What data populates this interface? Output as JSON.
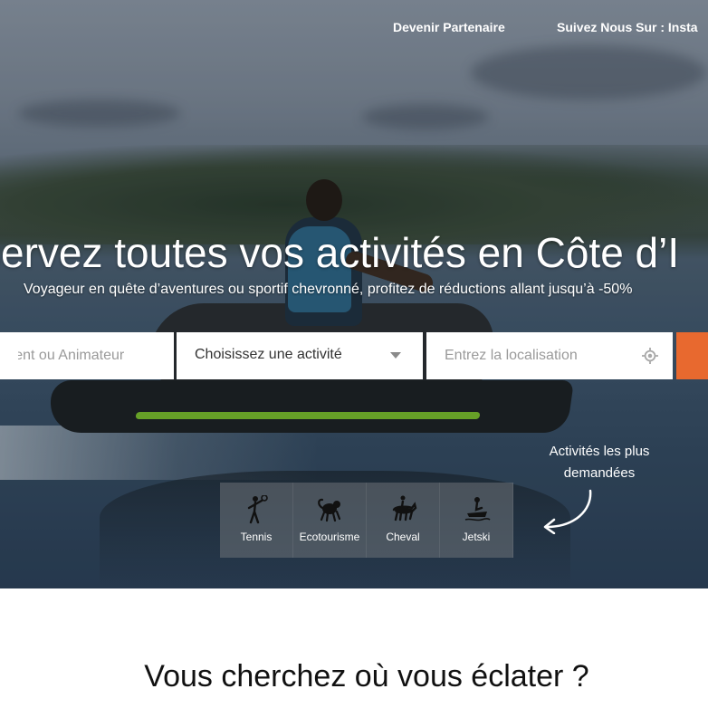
{
  "nav": {
    "partner": "Devenir Partenaire",
    "follow": "Suivez Nous Sur : Insta"
  },
  "hero": {
    "title": "servez toutes vos activités en Côte d’I",
    "subtitle": "Voyageur en quête d’aventures ou sportif chevronné, profitez de réductions allant jusqu’à -50%"
  },
  "search": {
    "field1_placeholder": "ement ou Animateur",
    "activity_select": "Choisissez une activité",
    "location_placeholder": "Entrez la localisation",
    "locate_icon": "crosshair-icon",
    "button_color": "#e8692f"
  },
  "popular": {
    "label": "Activités les plus demandées",
    "items": [
      {
        "label": "Tennis",
        "icon": "tennis-player-icon"
      },
      {
        "label": "Ecotourisme",
        "icon": "monkey-icon"
      },
      {
        "label": "Cheval",
        "icon": "horse-rider-icon"
      },
      {
        "label": "Jetski",
        "icon": "jetski-icon"
      }
    ]
  },
  "section": {
    "title": "Vous cherchez où vous éclater ?"
  },
  "colors": {
    "accent": "#e8692f",
    "text_dark": "#111111"
  }
}
